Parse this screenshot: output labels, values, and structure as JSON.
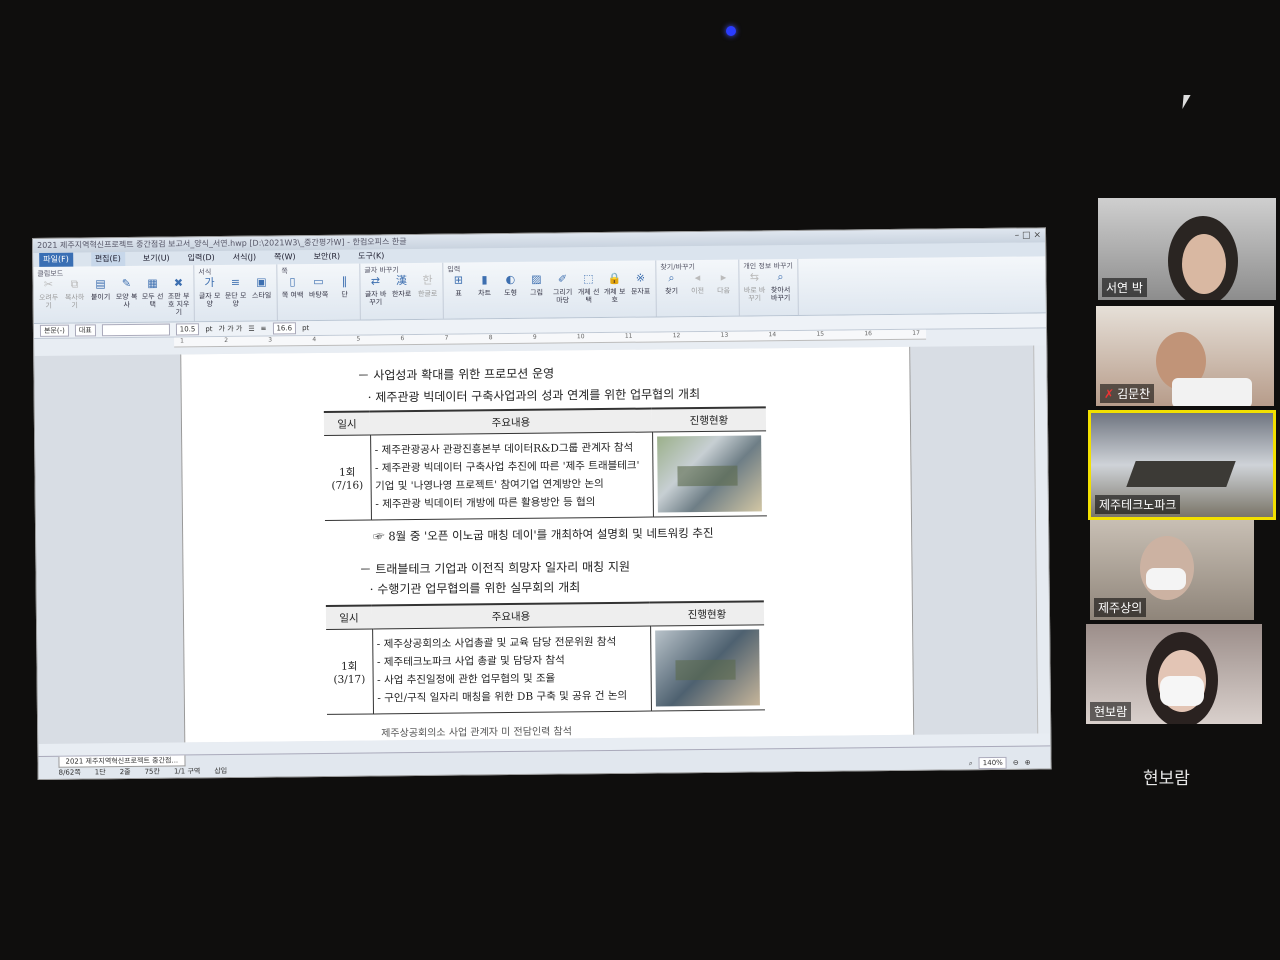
{
  "window": {
    "title": "2021 제주지역혁신프로젝트 중간점검 보고서_양식_서연.hwp [D:\\2021W3\\_중간평가W] - 한컴오피스 한글",
    "controls": [
      "–",
      "□",
      "×"
    ]
  },
  "menu": {
    "file": "파일(F)",
    "items": [
      "편집(E)",
      "보기(U)",
      "입력(D)",
      "서식(J)",
      "쪽(W)",
      "보안(R)",
      "도구(K)"
    ]
  },
  "ribbon": {
    "groups": [
      {
        "title": "클립보드",
        "buttons": [
          "오려두기",
          "복사하기",
          "붙이기",
          "모양 복사",
          "모두 선택",
          "조판 부호 지우기"
        ]
      },
      {
        "title": "서식",
        "buttons": [
          "글자 모양",
          "문단 모양",
          "스타일"
        ]
      },
      {
        "title": "쪽",
        "buttons": [
          "쪽 여백",
          "바탕쪽",
          "단"
        ]
      },
      {
        "title": "글자 바꾸기",
        "buttons": [
          "글자 바꾸기",
          "한자로",
          "한글로"
        ]
      },
      {
        "title": "입력",
        "buttons": [
          "표",
          "차트",
          "도형",
          "그림",
          "그리기마당",
          "개체 선택",
          "개체 보호",
          "문자표"
        ]
      },
      {
        "title": "찾기/바꾸기",
        "buttons": [
          "찾기",
          "이전",
          "다음"
        ]
      },
      {
        "title": "개인 정보 바꾸기",
        "buttons": [
          "바로 바꾸기",
          "찾아서 바꾸기"
        ]
      }
    ]
  },
  "formatbar": {
    "style": "본문(-)",
    "lang": "대표",
    "font": "",
    "size": "10.5",
    "unit": "pt",
    "bold_italic": "가 가 가",
    "line_spacing": "16.6",
    "line_unit": "pt"
  },
  "ruler": [
    "1",
    "2",
    "3",
    "4",
    "5",
    "6",
    "7",
    "8",
    "9",
    "10",
    "11",
    "12",
    "13",
    "14",
    "15",
    "16",
    "17"
  ],
  "document": {
    "line1": "－  사업성과 확대를 위한 프로모션 운영",
    "line2": "·  제주관광 빅데이터 구축사업과의 성과 연계를 위한 업무협의 개최",
    "table1": {
      "headers": [
        "일시",
        "주요내용",
        "진행현황"
      ],
      "date": "1회",
      "date_sub": "(7/16)",
      "items": [
        "- 제주관광공사 관광진흥본부 데이터R&D그룹 관계자 참석",
        "- 제주관광 빅데이터 구축사업 추진에 따른 '제주 트래블테크'",
        "  기업 및 '나영나영 프로젝트' 참여기업 연계방안 논의",
        "- 제주관광 빅데이터 개방에 따른 활용방안 등 협의"
      ]
    },
    "note": "☞ 8월 중 '오픈 이노굽 매칭 데이'를 개최하여 설명회 및 네트워킹 추진",
    "line3": "－  트래블테크 기업과 이전직 희망자 일자리 매칭 지원",
    "line4": "·  수행기관 업무협의를 위한 실무회의 개최",
    "table2": {
      "headers": [
        "일시",
        "주요내용",
        "진행현황"
      ],
      "date": "1회",
      "date_sub": "(3/17)",
      "items": [
        "- 제주상공회의소 사업총괄 및 교육 담당 전문위원 참석",
        "- 제주테크노파크 사업 총괄 및 담당자 참석",
        "- 사업 추진일정에 관한 업무협의 및 조율",
        "- 구인/구직 일자리 매칭을 위한 DB 구축 및 공유 건 논의"
      ],
      "cut_line": "제주상공회의소 사업 관계자 미 전담인력 참석"
    }
  },
  "statusbar": {
    "doc_tab": "2021 제주지역혁신프로젝트 중간점...",
    "page": "8/62쪽",
    "column": "1단",
    "line": "2줄",
    "col": "75칸",
    "section": "1/1 구역",
    "mode": "삽입",
    "zoom": "140%"
  },
  "participants": [
    {
      "name": "서연 박",
      "muted": false
    },
    {
      "name": "김문찬",
      "muted": true
    },
    {
      "name": "제주테크노파크",
      "muted": false,
      "active": true
    },
    {
      "name": "제주상의",
      "muted": false
    },
    {
      "name": "현보람",
      "muted": false
    }
  ],
  "active_speaker_name": "현보람",
  "colors": {
    "active_border": "#f2e000",
    "mute_icon": "#e33333",
    "file_menu": "#3a6fb4"
  }
}
